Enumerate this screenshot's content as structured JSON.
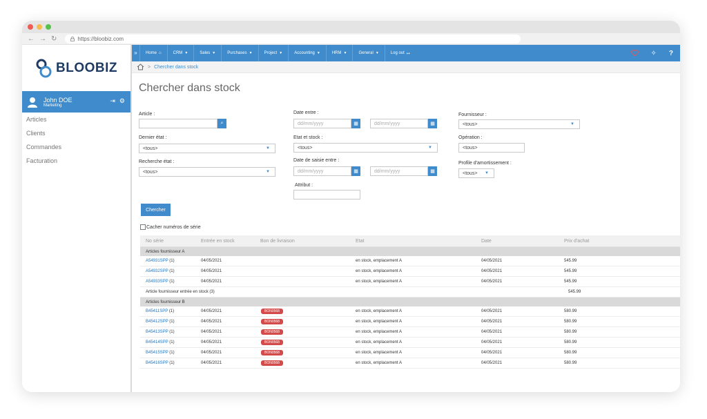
{
  "browser": {
    "dots": [
      "#ee5c54",
      "#f5bd4f",
      "#57c24a"
    ],
    "nav_icons": [
      "←",
      "→",
      "↻"
    ],
    "url": "https://bloobiz.com"
  },
  "brand": {
    "name": "BLOOBIZ",
    "color": "#1f3a63",
    "accent": "#3f8bcb"
  },
  "user": {
    "name": "John DOE",
    "role": "Marketing"
  },
  "sidebar": {
    "items": [
      {
        "label": "Articles"
      },
      {
        "label": "Clients"
      },
      {
        "label": "Commandes"
      },
      {
        "label": "Facturation"
      }
    ]
  },
  "topnav": {
    "toggle": "»",
    "items": [
      {
        "label": "Home",
        "icon": "home-outline-icon",
        "glyph": "⌂",
        "caret": ""
      },
      {
        "label": "CRM",
        "caret": "▼"
      },
      {
        "label": "Sales",
        "caret": "▼"
      },
      {
        "label": "Purchases",
        "caret": "▼"
      },
      {
        "label": "Project",
        "caret": "▼"
      },
      {
        "label": "Accounting",
        "caret": "▼"
      },
      {
        "label": "HRM",
        "caret": "▼"
      },
      {
        "label": "General",
        "caret": "▼"
      },
      {
        "label": "Log out",
        "caret": "",
        "glyph": "↦"
      }
    ],
    "right_tools": {
      "magic": "✧",
      "help": "?"
    }
  },
  "breadcrumb": {
    "separator": ">",
    "current": "Chercher dans stock"
  },
  "page": {
    "title": "Chercher dans stock"
  },
  "form": {
    "article": {
      "label": "Article :",
      "value": ""
    },
    "dernier_etat": {
      "label": "Dernier état :",
      "value": "<tous>"
    },
    "recherche_etat": {
      "label": "Recherche état :",
      "value": "<tous>"
    },
    "date_entre": {
      "label": "Date entre :",
      "from_placeholder": "dd/mm/yyyy",
      "to_placeholder": "dd/mm/yyyy"
    },
    "etat_stock": {
      "label": "Etat et stock :",
      "value": "<tous>"
    },
    "date_saisie": {
      "label": "Date de saisie entre :",
      "from_placeholder": "dd/mm/yyyy",
      "to_placeholder": "dd/mm/yyyy"
    },
    "attribut": {
      "label": "Attribut :",
      "value": ""
    },
    "fournisseur": {
      "label": "Fournisseur :",
      "value": "<tous>"
    },
    "operation": {
      "label": "Opération :",
      "value": "<tous>"
    },
    "profile": {
      "label": "Profile d'amortissement :",
      "value": "<tous>"
    },
    "search_button": "Chercher",
    "hide_serials": "Cacher numéros de série"
  },
  "table": {
    "headers": [
      "No série",
      "Entrée en stock",
      "Bon de livraison",
      "Etat",
      "Date",
      "Prix d'achat"
    ],
    "groups": [
      {
        "title": "Articles fournisseur A",
        "rows": [
          {
            "serial": "A54931SPP",
            "qty": "(1)",
            "entry": "04/05/2021",
            "bl": "",
            "etat": "en stock, emplacement A",
            "date": "04/05/2021",
            "price": "545.99"
          },
          {
            "serial": "A54932SPP",
            "qty": "(1)",
            "entry": "04/05/2021",
            "bl": "",
            "etat": "en stock, emplacement A",
            "date": "04/05/2021",
            "price": "545.99"
          },
          {
            "serial": "A54933SPP",
            "qty": "(1)",
            "entry": "04/05/2021",
            "bl": "",
            "etat": "en stock, emplacement A",
            "date": "04/05/2021",
            "price": "545.99"
          }
        ],
        "subtotal": {
          "label": "Article fournisseur entrée en stock (3)",
          "price": "545.99"
        }
      },
      {
        "title": "Articles fournisseur B",
        "rows": [
          {
            "serial": "B45411SPP",
            "qty": "(1)",
            "entry": "04/05/2021",
            "bl": "BON0568",
            "etat": "en stock, emplacement A",
            "date": "04/05/2021",
            "price": "580.99"
          },
          {
            "serial": "B45412SPP",
            "qty": "(1)",
            "entry": "04/05/2021",
            "bl": "BON0568",
            "etat": "en stock, emplacement A",
            "date": "04/05/2021",
            "price": "580.99"
          },
          {
            "serial": "B45413SPP",
            "qty": "(1)",
            "entry": "04/05/2021",
            "bl": "BON0568",
            "etat": "en stock, emplacement A",
            "date": "04/05/2021",
            "price": "580.99"
          },
          {
            "serial": "B45414SPP",
            "qty": "(1)",
            "entry": "04/05/2021",
            "bl": "BON0568",
            "etat": "en stock, emplacement A",
            "date": "04/05/2021",
            "price": "580.99"
          },
          {
            "serial": "B45415SPP",
            "qty": "(1)",
            "entry": "04/05/2021",
            "bl": "BON0568",
            "etat": "en stock, emplacement A",
            "date": "04/05/2021",
            "price": "580.99"
          },
          {
            "serial": "B45416SPP",
            "qty": "(1)",
            "entry": "04/05/2021",
            "bl": "BON0568",
            "etat": "en stock, emplacement A",
            "date": "04/05/2021",
            "price": "580.99"
          }
        ]
      }
    ]
  }
}
